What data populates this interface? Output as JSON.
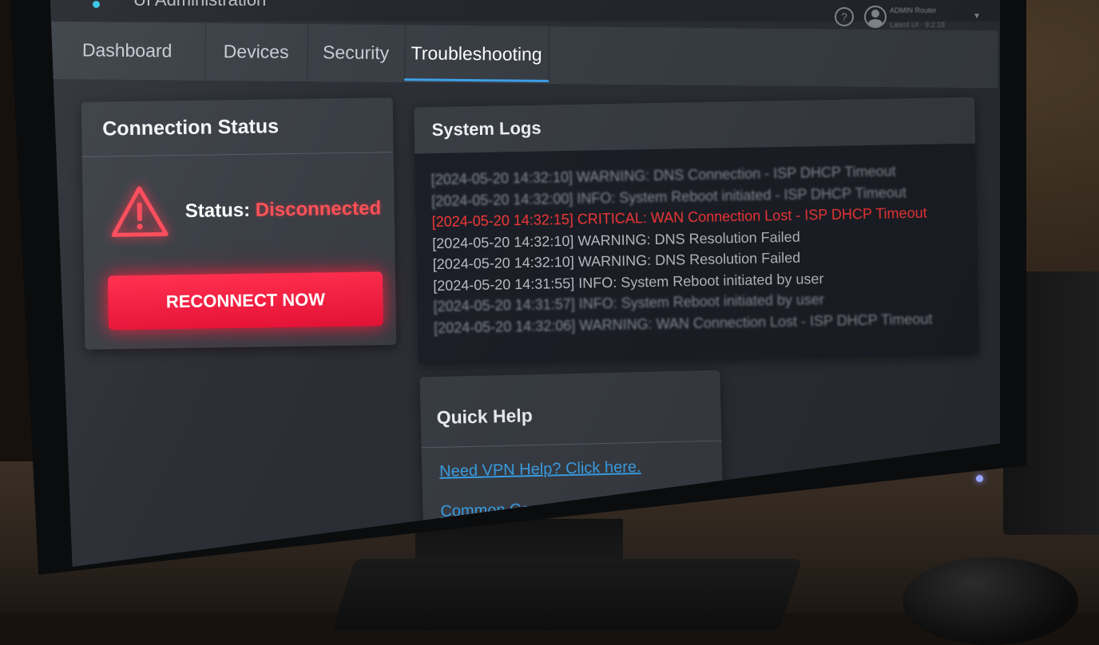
{
  "app": {
    "title": "UI Administration"
  },
  "user": {
    "name": "ADMIN Router",
    "sub": "Latest UI · 9:2:18"
  },
  "tabs": [
    {
      "label": "Dashboard"
    },
    {
      "label": "Devices"
    },
    {
      "label": "Security"
    },
    {
      "label": "Troubleshooting",
      "active": true
    }
  ],
  "connection": {
    "title": "Connection Status",
    "status_label": "Status:",
    "status_value": "Disconnected",
    "button_label": "RECONNECT NOW"
  },
  "logs": {
    "title": "System Logs",
    "entries": [
      "[2024-05-20 14:32:10] WARNING: DNS Connection - ISP DHCP Timeout",
      "[2024-05-20 14:32:00] INFO: System Reboot initiated - ISP DHCP Timeout",
      "[2024-05-20 14:32:15] CRITICAL: WAN Connection Lost - ISP DHCP Timeout",
      "[2024-05-20 14:32:10] WARNING: DNS Resolution Failed",
      "[2024-05-20 14:32:10] WARNING: DNS Resolution Failed",
      "[2024-05-20 14:31:55] INFO: System Reboot initiated by user",
      "[2024-05-20 14:31:57] INFO: System Reboot initiated by user",
      "[2024-05-20 14:32:06] WARNING: WAN Connection Lost - ISP DHCP Timeout"
    ]
  },
  "help": {
    "title": "Quick Help",
    "links": [
      {
        "label": "Need VPN Help? Click here."
      },
      {
        "label": "Common Connection Issues FAQ"
      }
    ]
  },
  "colors": {
    "accent": "#3ea3ee",
    "danger": "#ff2d4d",
    "critical_text": "#ff3a3a",
    "link": "#3da6f0"
  },
  "icons": [
    "help-icon",
    "user-avatar-icon",
    "chevron-down-icon",
    "warning-triangle-icon"
  ]
}
